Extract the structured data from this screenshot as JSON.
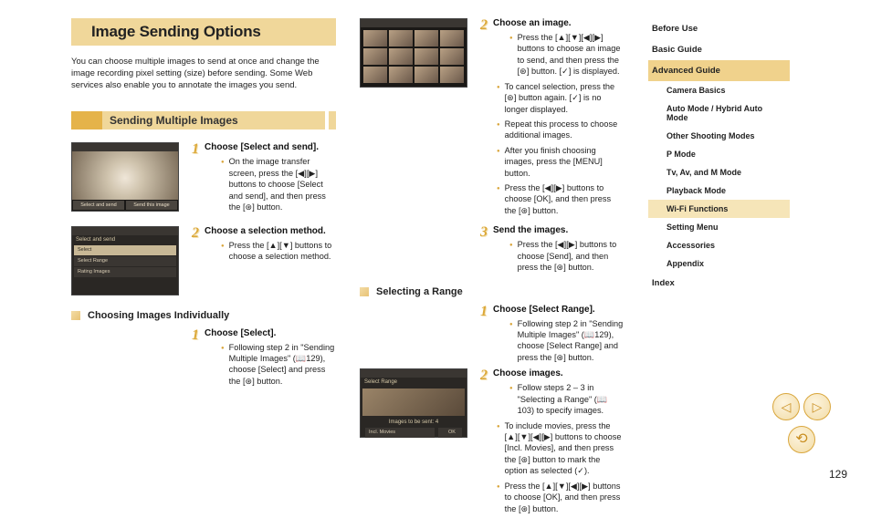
{
  "title": "Image Sending Options",
  "intro": "You can choose multiple images to send at once and change the image recording pixel setting (size) before sending. Some Web services also enable you to annotate the images you send.",
  "sec1": {
    "heading": "Sending Multiple Images",
    "step1": {
      "title": "Choose [Select and send].",
      "b1": "On the image transfer screen, press the [◀][▶] buttons to choose [Select and send], and then press the [⊛] button."
    },
    "step2": {
      "title": "Choose a selection method.",
      "b1": "Press the [▲][▼] buttons to choose a selection method."
    },
    "shot1": {
      "btnL": "Select and send",
      "btnR": "Send this image"
    },
    "shot2": {
      "hdr": "Select and send",
      "r1": "Select",
      "r2": "Select Range",
      "r3": "Rating Images"
    }
  },
  "sec2": {
    "heading": "Choosing Images Individually",
    "step1": {
      "title": "Choose [Select].",
      "b1": "Following step 2 in \"Sending Multiple Images\" (📖129), choose [Select] and press the [⊛] button."
    },
    "step2": {
      "title": "Choose an image.",
      "b1": "Press the [▲][▼][◀][▶] buttons to choose an image to send, and then press the [⊛] button. [✓] is displayed.",
      "b2": "To cancel selection, press the [⊛] button again. [✓] is no longer displayed.",
      "b3": "Repeat this process to choose additional images.",
      "b4": "After you finish choosing images, press the [MENU] button.",
      "b5": "Press the [◀][▶] buttons to choose [OK], and then press the [⊛] button."
    },
    "step3": {
      "title": "Send the images.",
      "b1": "Press the [◀][▶] buttons to choose [Send], and then press the [⊛] button."
    }
  },
  "sec3": {
    "heading": "Selecting a Range",
    "step1": {
      "title": "Choose [Select Range].",
      "b1": "Following step 2 in \"Sending Multiple Images\" (📖129), choose [Select Range] and press the [⊛] button."
    },
    "step2": {
      "title": "Choose images.",
      "b1": "Follow steps 2 – 3 in \"Selecting a Range\" (📖 103) to specify images.",
      "b2": "To include movies, press the [▲][▼][◀][▶] buttons to choose [Incl. Movies], and then press the [⊛] button to mark the option as selected (✓).",
      "b3": "Press the [▲][▼][◀][▶] buttons to choose [OK], and then press the [⊛] button."
    },
    "shot": {
      "hdr": "Select Range",
      "count": "Images to be sent: 4",
      "chk": "Incl. Movies",
      "ok": "OK"
    }
  },
  "nav": {
    "before": "Before Use",
    "basic": "Basic Guide",
    "adv": "Advanced Guide",
    "sub": {
      "cam": "Camera Basics",
      "auto": "Auto Mode / Hybrid Auto Mode",
      "other": "Other Shooting Modes",
      "p": "P Mode",
      "tv": "Tv, Av, and M Mode",
      "play": "Playback Mode",
      "wifi": "Wi-Fi Functions",
      "set": "Setting Menu",
      "acc": "Accessories",
      "app": "Appendix"
    },
    "index": "Index"
  },
  "pagenum": "129"
}
